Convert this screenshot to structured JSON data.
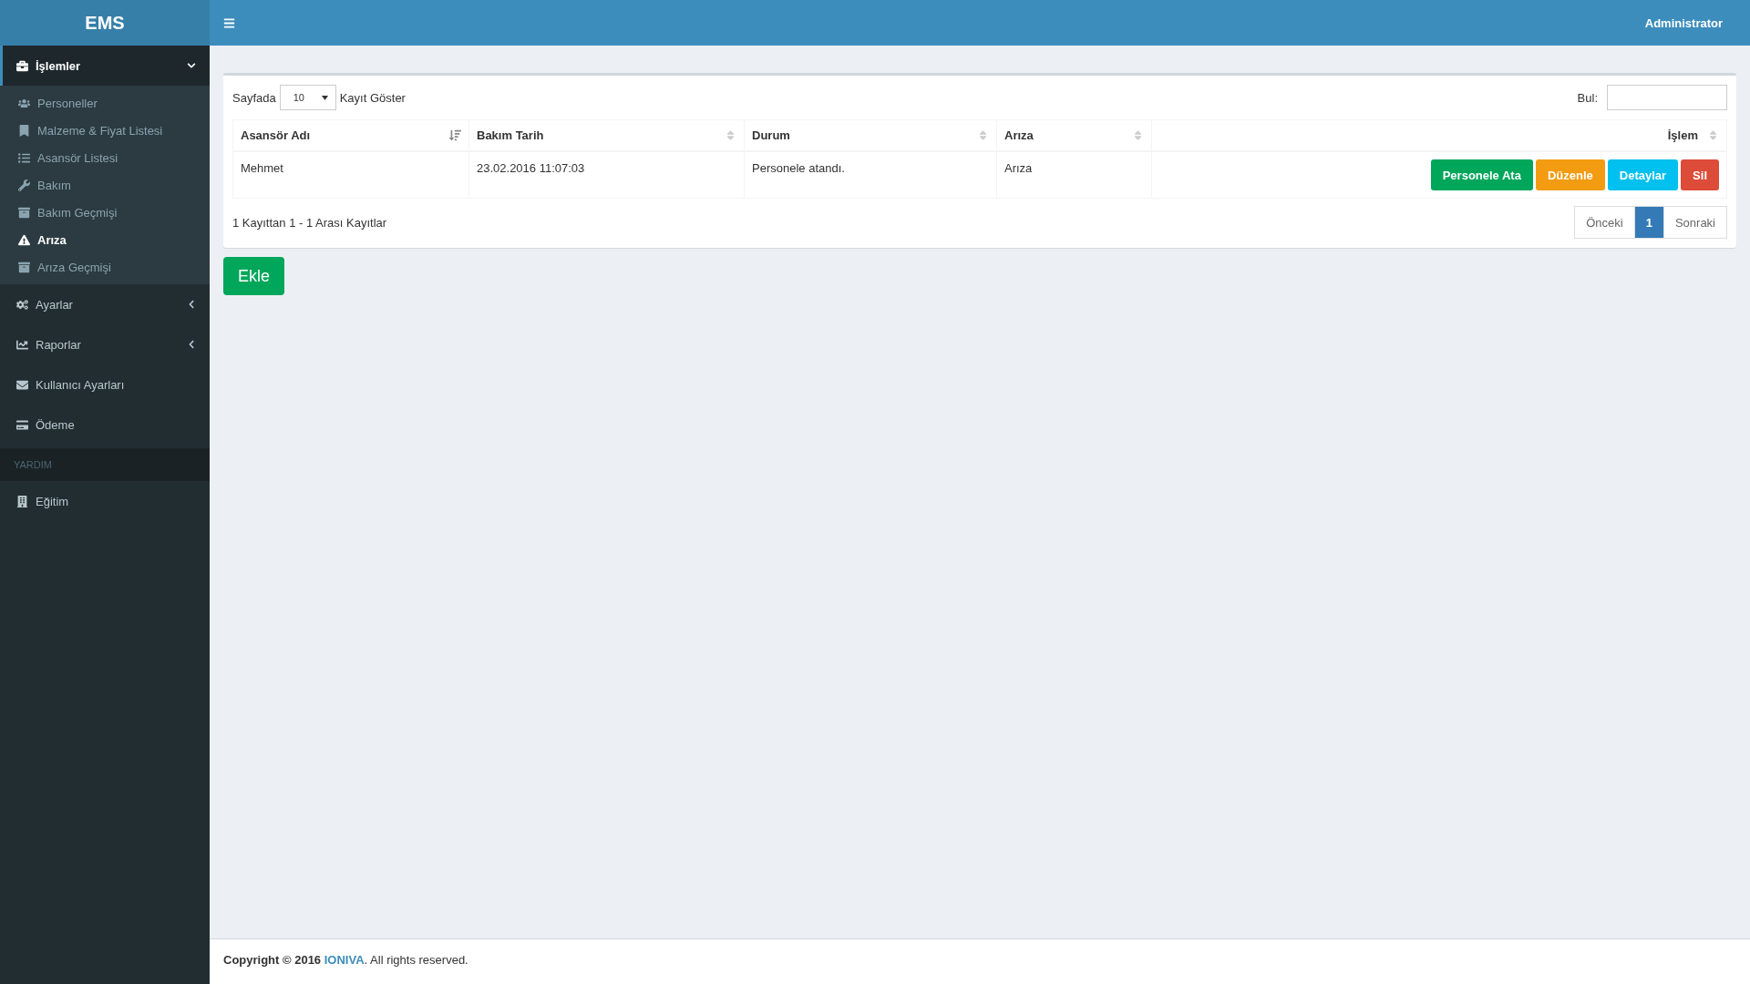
{
  "brand": "EMS",
  "header": {
    "user": "Administrator"
  },
  "sidebar": {
    "groups": [
      {
        "label": "İşlemler",
        "expanded": true,
        "children": [
          {
            "label": "Personeller",
            "selected": false
          },
          {
            "label": "Malzeme & Fiyat Listesi",
            "selected": false
          },
          {
            "label": "Asansör Listesi",
            "selected": false
          },
          {
            "label": "Bakım",
            "selected": false
          },
          {
            "label": "Bakım Geçmişi",
            "selected": false
          },
          {
            "label": "Arıza",
            "selected": true
          },
          {
            "label": "Arıza Geçmişi",
            "selected": false
          }
        ]
      },
      {
        "label": "Ayarlar",
        "expanded": false
      },
      {
        "label": "Raporlar",
        "expanded": false
      },
      {
        "label": "Kullanıcı Ayarları"
      },
      {
        "label": "Ödeme"
      }
    ],
    "section": "YARDIM",
    "help_items": [
      {
        "label": "Eğitim"
      }
    ]
  },
  "table_controls": {
    "prefix": "Sayfada",
    "page_size": "10",
    "suffix": "Kayıt Göster",
    "search_label": "Bul:"
  },
  "table": {
    "columns": [
      {
        "label": "Asansör Adı",
        "sorted": true
      },
      {
        "label": "Bakım Tarih",
        "sorted": false
      },
      {
        "label": "Durum",
        "sorted": false
      },
      {
        "label": "Arıza",
        "sorted": false
      },
      {
        "label": "İşlem",
        "sorted": false
      }
    ],
    "rows": [
      {
        "cells": [
          "Mehmet",
          "23.02.2016 11:07:03",
          "Personele atandı.",
          "Arıza"
        ],
        "actions": [
          {
            "label": "Personele Ata",
            "color": "#00a65a"
          },
          {
            "label": "Düzenle",
            "color": "#f39c12"
          },
          {
            "label": "Detaylar",
            "color": "#00c0ef"
          },
          {
            "label": "Sil",
            "color": "#dd4b39"
          }
        ]
      }
    ]
  },
  "info": "1 Kayıttan 1 - 1 Arası Kayıtlar",
  "pagination": {
    "previous": "Önceki",
    "pages": [
      {
        "label": "1",
        "selected": true
      }
    ],
    "next": "Sonraki"
  },
  "add_button": "Ekle",
  "footer": {
    "prefix": "Copyright © 2016",
    "link": "IONIVA",
    "suffix": ". All rights reserved."
  }
}
